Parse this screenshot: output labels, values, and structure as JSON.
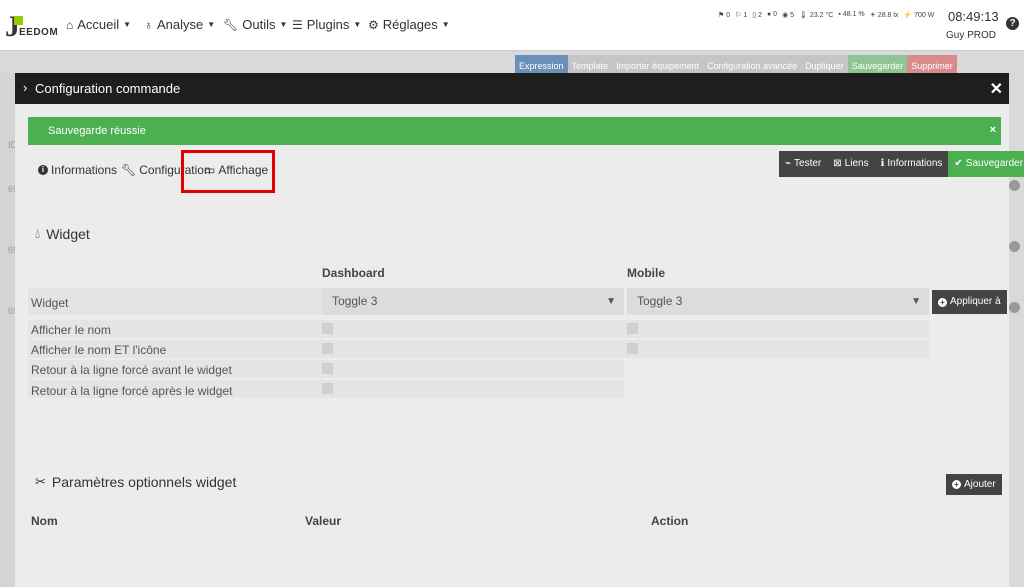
{
  "logo": {
    "letter": "J",
    "text": "EEDOM"
  },
  "nav": {
    "accueil": "Accueil",
    "analyse": "Analyse",
    "outils": "Outils",
    "plugins": "Plugins",
    "reglages": "Réglages"
  },
  "status": [
    "0",
    "1",
    "2",
    "0",
    "5",
    "23.2 °C",
    "48.1 %",
    "28.8 lx",
    "700 W"
  ],
  "clock": "08:49:13",
  "user": "Guy PROD",
  "bg_toolbar": [
    {
      "label": "Expression",
      "color": "#6a8fb9"
    },
    {
      "label": "Template",
      "color": "#c5c5c5"
    },
    {
      "label": "Importer équipement",
      "color": "#c5c5c5"
    },
    {
      "label": "Configuration avancée",
      "color": "#c5c5c5"
    },
    {
      "label": "Dupliquer",
      "color": "#c5c5c5"
    },
    {
      "label": "Sauvegarder",
      "color": "#8fc493"
    },
    {
      "label": "Supprimer",
      "color": "#d98b8b"
    }
  ],
  "bg_labels": {
    "id": "ID",
    "num1": "69",
    "num2": "69",
    "num3": "69"
  },
  "modal": {
    "title": "Configuration commande"
  },
  "alert": {
    "text": "Sauvegarde réussie",
    "close": "×"
  },
  "tabs": {
    "informations": "Informations",
    "configuration": "Configuration",
    "affichage": "Affichage"
  },
  "actions": {
    "tester": "Tester",
    "liens": "Liens",
    "informations": "Informations",
    "sauvegarder": "Sauvegarder"
  },
  "widget_section": {
    "title": "Widget",
    "dashboard": "Dashboard",
    "mobile": "Mobile",
    "rows": {
      "widget": "Widget",
      "afficher_nom": "Afficher le nom",
      "afficher_nom_icone": "Afficher le nom ET l'icône",
      "retour_avant": "Retour à la ligne forcé avant le widget",
      "retour_apres": "Retour à la ligne forcé après le widget"
    },
    "dashboard_value": "Toggle 3",
    "mobile_value": "Toggle 3",
    "appliquer": "Appliquer à"
  },
  "params_section": {
    "title": "Paramètres optionnels widget",
    "ajouter": "Ajouter",
    "col_nom": "Nom",
    "col_valeur": "Valeur",
    "col_action": "Action"
  },
  "colors": {
    "success": "#4caf50",
    "dark": "#1e1e1e",
    "highlight": "#e00000"
  }
}
